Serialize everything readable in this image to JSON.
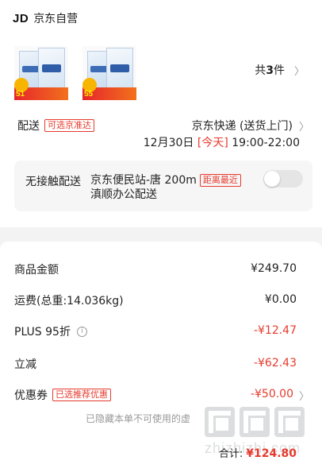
{
  "shop": {
    "logo": "JD",
    "name": "京东自营"
  },
  "products": {
    "items": [
      {
        "name": "milk-carton-box",
        "promo_price": "51"
      },
      {
        "name": "milk-carton-box",
        "promo_price": "55"
      }
    ],
    "count_prefix": "共",
    "count": "3",
    "count_suffix": "件"
  },
  "delivery": {
    "label": "配送",
    "tag": "可选京准达",
    "method": "京东快递 (送货上门)",
    "date": "12月30日",
    "today": "[今天]",
    "time": "19:00-22:00"
  },
  "contactless": {
    "title": "无接触配送",
    "place": "京东便民站-唐 200m",
    "place_line2": "滇顺办公配送",
    "near_tag": "距离最近",
    "enabled": false
  },
  "summary": {
    "goods_label": "商品金额",
    "goods_value": "¥249.70",
    "freight_label": "运费(总重:14.036kg)",
    "freight_value": "¥0.00",
    "plus_label": "PLUS 95折",
    "plus_value": "-¥12.47",
    "instant_label": "立减",
    "instant_value": "-¥62.43",
    "coupon_label": "优惠券",
    "coupon_tag": "已选推荐优惠",
    "coupon_value": "-¥50.00",
    "hidden_note": "已隐藏本单不可使用的虚",
    "total_label": "合计:",
    "total_value": "¥124.80"
  },
  "watermark": {
    "text": "zhizhizhi.com"
  },
  "colors": {
    "accent": "#e63b2e",
    "background": "#f3f3f3"
  }
}
